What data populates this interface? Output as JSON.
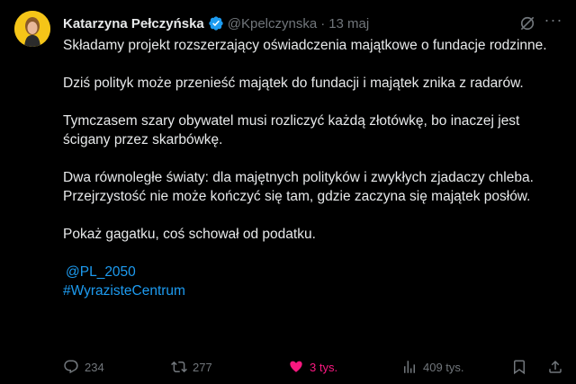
{
  "author": {
    "name": "Katarzyna Pełczyńska",
    "handle": "@Kpelczynska",
    "separator": "·",
    "date": "13 maj"
  },
  "tweet": {
    "paragraphs": [
      "Składamy projekt rozszerzający oświadczenia majątkowe o fundacje rodzinne.",
      "Dziś polityk może przenieść majątek do fundacji i majątek znika z radarów.",
      "Tymczasem szary obywatel musi rozliczyć każdą złotówkę, bo inaczej jest ścigany przez skarbówkę.",
      "Dwa równoległe światy: dla majętnych polityków i zwykłych zjadaczy chleba.",
      "Przejrzystość nie może kończyć się tam, gdzie zaczyna się majątek posłów.",
      "Pokaż gagatku, coś schował od podatku."
    ],
    "mention": "@PL_2050",
    "hashtag": "#WyrazisteCentrum"
  },
  "actions": {
    "replies": "234",
    "reposts": "277",
    "likes": "3 tys.",
    "views": "409 tys."
  },
  "colors": {
    "background": "#000000",
    "text": "#e7e9ea",
    "muted": "#71767b",
    "link": "#1d9bf0",
    "like": "#f91880",
    "verified": "#1d9bf0"
  }
}
